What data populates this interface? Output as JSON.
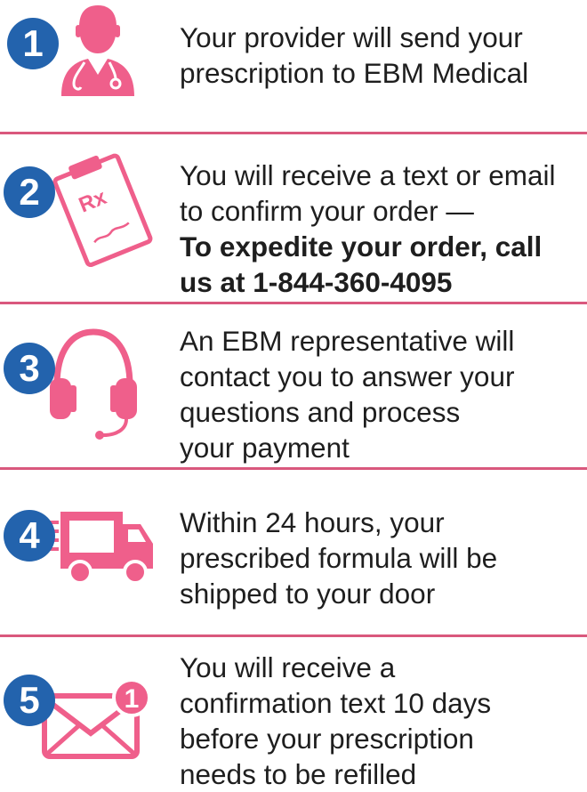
{
  "colors": {
    "accent": "#ef5f8b",
    "badge": "#2363ad",
    "divider": "#d9587d"
  },
  "steps": [
    {
      "number": "1",
      "icon": "doctor-icon",
      "lines": [
        "Your provider will send your",
        "prescription to EBM Medical"
      ]
    },
    {
      "number": "2",
      "icon": "prescription-clipboard-icon",
      "icon_text": "Rx",
      "lines": [
        "You will receive a text or email",
        "to confirm your order —"
      ],
      "bold_lines": [
        "To expedite your order, call",
        "us at 1-844-360-4095"
      ]
    },
    {
      "number": "3",
      "icon": "headset-icon",
      "lines": [
        "An EBM representative will",
        "contact you to answer your",
        "questions and process",
        "your payment"
      ]
    },
    {
      "number": "4",
      "icon": "delivery-truck-icon",
      "lines": [
        "Within 24 hours, your",
        "prescribed formula will be",
        "shipped to your door"
      ]
    },
    {
      "number": "5",
      "icon": "envelope-notification-icon",
      "icon_badge": "1",
      "lines": [
        "You will receive a",
        "confirmation text 10 days",
        "before your prescription",
        "needs to be refilled"
      ]
    }
  ]
}
